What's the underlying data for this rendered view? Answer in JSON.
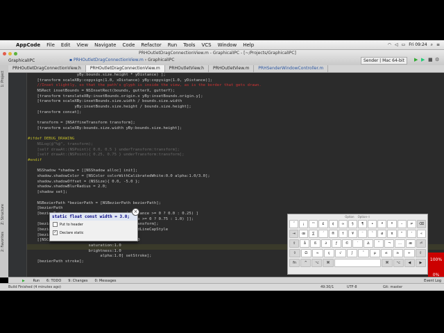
{
  "menubar": {
    "apple": "",
    "items": [
      "AppCode",
      "File",
      "Edit",
      "View",
      "Navigate",
      "Code",
      "Refactor",
      "Run",
      "Tools",
      "VCS",
      "Window",
      "Help"
    ],
    "clock": "Fri 09:24"
  },
  "window": {
    "title": "PRHOutletDragConnectionView.m - GraphicalIPC - [~/Projects/GraphicalIPC]",
    "project": "GraphicalIPC",
    "breadcrumb_file": "PRHOutletDragConnectionView.m",
    "breadcrumb_project": "GraphicalIPC",
    "scheme": "Sender | Mac 64-bit"
  },
  "tabs": [
    "PRHOutletDragConnectionView.h",
    "PRHOutletDragConnectionView.m",
    "PRHOutletView.h",
    "PRHOutletView.m",
    "PRHSenderWindowController.m"
  ],
  "left_strip": {
    "project": "1: Project",
    "structure": "Z: Structure",
    "favorites": "2: Favorites"
  },
  "code_lines": [
    {
      "t": "                     yBy:bounds.size.height * yDistance) ];",
      "c": "#cbcbcb"
    },
    {
      "t": "    [transform scaleXBy:copysign(1.0, xDistance) yBy:copysign(1.0, yDistance)];",
      "c": "#cbcbcb"
    },
    {
      "t": "    //Inset slightly, so that the path's glyph is inside the view, as is the border that gets drawn.",
      "c": "#c33"
    },
    {
      "t": "    NSRect insetBounds = NSInsetRect(bounds, gutterX, gutterY);",
      "c": "#cbcbcb"
    },
    {
      "t": "    [transform translateXBy:insetBounds.origin.x yBy:insetBounds.origin.y];",
      "c": "#cbcbcb"
    },
    {
      "t": "    [transform scaleXBy:insetBounds.size.width / bounds.size.width",
      "c": "#cbcbcb"
    },
    {
      "t": "                    yBy:insetBounds.size.height / bounds.size.height];",
      "c": "#cbcbcb"
    },
    {
      "t": "    [transform concat];",
      "c": "#cbcbcb"
    },
    {
      "t": "",
      "c": "#cbcbcb"
    },
    {
      "t": "    transform = [NSAffineTransform transform];",
      "c": "#cbcbcb"
    },
    {
      "t": "    [transform scaleXBy:bounds.size.width yBy:bounds.size.height];",
      "c": "#cbcbcb"
    },
    {
      "t": "",
      "c": "#cbcbcb"
    },
    {
      "t": "#ifdef DEBUG_DRAWING",
      "c": "#bbb529"
    },
    {
      "t": "    NSLog(@\"%@\", transform);",
      "c": "#6a6a6a"
    },
    {
      "t": "    [self drawAt:(NSPoint){ 0.0, 0.5 } underTransform:transform];",
      "c": "#6a6a6a"
    },
    {
      "t": "    [self drawAt:(NSPoint){ 0.25, 0.75 } underTransform:transform];",
      "c": "#6a6a6a"
    },
    {
      "t": "#endif",
      "c": "#bbb529"
    },
    {
      "t": "",
      "c": "#cbcbcb"
    },
    {
      "t": "    NSShadow *shadow = [[NSShadow alloc] init];",
      "c": "#cbcbcb"
    },
    {
      "t": "    shadow.shadowColor = [NSColor colorWithCalibratedWhite:0.0 alpha:1.0/3.0];",
      "c": "#cbcbcb"
    },
    {
      "t": "    shadow.shadowOffset = (NSSize){ 0.0, -5.0 };",
      "c": "#cbcbcb"
    },
    {
      "t": "    shadow.shadowBlurRadius = 2.0;",
      "c": "#cbcbcb"
    },
    {
      "t": "    [shadow set];",
      "c": "#cbcbcb"
    },
    {
      "t": "",
      "c": "#cbcbcb"
    },
    {
      "t": "    NSBezierPath *bezierPath = [NSBezierPath bezierPath];",
      "c": "#cbcbcb"
    },
    {
      "t": "    [bezierPath",
      "c": "#cbcbcb"
    },
    {
      "t": "    [bezierPath                          y(yDistance >= 0 ? 0.0 : 0.25) ]",
      "c": "#cbcbcb"
    },
    {
      "t": "                                       yDistance >= 0 ? 0.75 : 1.0) ]];",
      "c": "#cbcbcb"
    },
    {
      "t": "    [bezierPath                              transform];",
      "c": "#cbcbcb"
    },
    {
      "t": "    [bezierPath setLineCap               NSRoundLineCapStyle",
      "c": "#cbcbcb"
    },
    {
      "t": "    [bezierPath setLineWidth:     ];",
      "c": "#cbcbcb"
    },
    {
      "t": "    [[NSColor colorWithCalibratedHue:210.0/360.0",
      "c": "#cbcbcb"
    },
    {
      "t": "                          saturation:1.0",
      "c": "#cbcbcb"
    },
    {
      "t": "                          brightness:1.0",
      "c": "#cbcbcb"
    },
    {
      "t": "                               alpha:1.0] setStroke];",
      "c": "#cbcbcb"
    },
    {
      "t": "    [bezierPath stroke];",
      "c": "#cbcbcb"
    }
  ],
  "popup": {
    "declaration": "static float const width = 3.0;",
    "option1": "Put to header",
    "option2": "Declare static",
    "option2_checked": "✓",
    "close_glyph": "×"
  },
  "keyboard": {
    "header_left": "Option",
    "header_right": "Option-⇧",
    "rows": [
      [
        "˝",
        "¡",
        "™",
        "£",
        "¢",
        "∞",
        "§",
        "¶",
        "•",
        "ª",
        "º",
        "–",
        "≠",
        "⌫"
      ],
      [
        "⇥",
        "œ",
        "∑",
        "´",
        "®",
        "†",
        "¥",
        "¨",
        "ˆ",
        "ø",
        "π",
        "“",
        "‘",
        "«"
      ],
      [
        "⇪",
        "å",
        "ß",
        "∂",
        "ƒ",
        "©",
        "˙",
        "∆",
        "˚",
        "¬",
        "…",
        "æ",
        "⏎"
      ],
      [
        "⇧",
        "Ω",
        "≈",
        "ç",
        "√",
        "∫",
        "˜",
        "µ",
        "≤",
        "≥",
        "÷",
        "⇧"
      ],
      [
        "fn",
        "^",
        "⌥",
        "⌘",
        "",
        "⌘",
        "⌥",
        "◀",
        "▶"
      ]
    ]
  },
  "red_badge": {
    "top": "100%",
    "bottom": "0%"
  },
  "bottom_tools": [
    "Run",
    "6: TODO",
    "9: Changes",
    "0: Messages"
  ],
  "bottom_right": "Event Log",
  "status": {
    "message": "Build Finished (4 minutes ago)",
    "position": "49:30/1",
    "encoding": "UTF-8",
    "git": "Git: master"
  },
  "colors": {
    "editor_bg": "#2b2b2b",
    "keyword": "#cc7832",
    "number": "#6897bb",
    "comment": "#c33",
    "preprocessor": "#bbb529"
  }
}
